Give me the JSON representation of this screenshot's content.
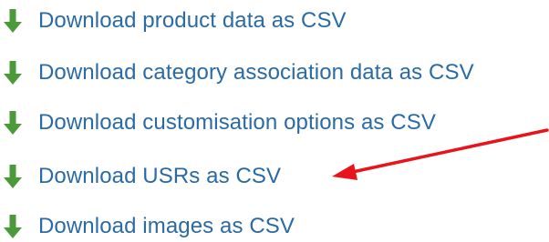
{
  "colors": {
    "link": "#2a6aa5",
    "download_icon": "#4b9a3a",
    "annotation": "#e8131b"
  },
  "downloads": [
    {
      "label": "Download product data as CSV",
      "icon": "download-arrow-icon"
    },
    {
      "label": "Download category association data as CSV",
      "icon": "download-arrow-icon"
    },
    {
      "label": "Download customisation options as CSV",
      "icon": "download-arrow-icon"
    },
    {
      "label": "Download USRs as CSV",
      "icon": "download-arrow-icon"
    },
    {
      "label": "Download images as CSV",
      "icon": "download-arrow-icon"
    }
  ],
  "annotation": {
    "shape": "red-arrow",
    "points_to": "Download USRs as CSV"
  }
}
